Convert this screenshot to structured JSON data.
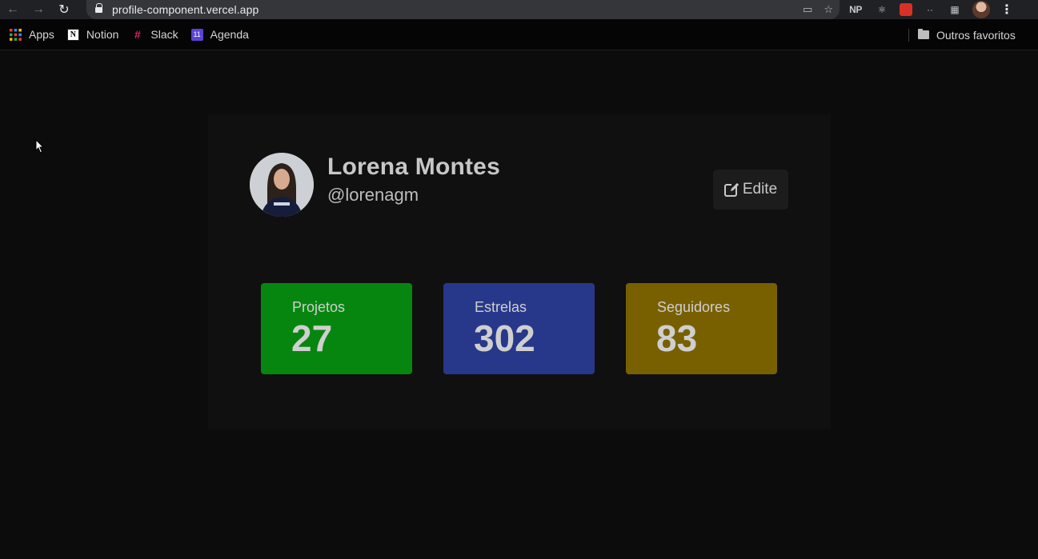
{
  "browser": {
    "url": "profile-component.vercel.app",
    "extensions": [
      "NP"
    ],
    "bookmarks": [
      {
        "label": "Apps",
        "icon": "apps-grid-icon"
      },
      {
        "label": "Notion",
        "icon": "notion-icon"
      },
      {
        "label": "Slack",
        "icon": "slack-icon"
      },
      {
        "label": "Agenda",
        "icon": "calendar-icon",
        "badge": "11"
      }
    ],
    "other_bookmarks": "Outros favoritos"
  },
  "profile": {
    "name": "Lorena Montes",
    "handle": "@lorenagm",
    "edit_label": "Edite"
  },
  "stats": [
    {
      "label": "Projetos",
      "value": "27",
      "color": "#06860f"
    },
    {
      "label": "Estrelas",
      "value": "302",
      "color": "#27388a"
    },
    {
      "label": "Seguidores",
      "value": "83",
      "color": "#786000"
    }
  ]
}
